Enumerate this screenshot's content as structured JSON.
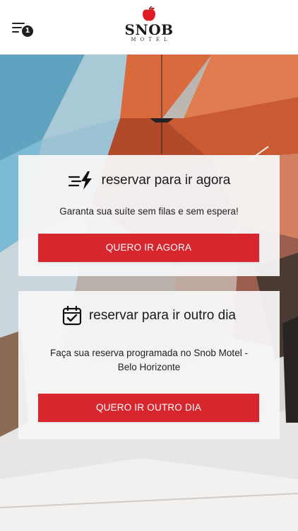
{
  "header": {
    "notification_count": "1",
    "logo": {
      "name": "SNOB",
      "subtitle": "MOTEL"
    }
  },
  "now_card": {
    "icon": "fast-lightning-icon",
    "title": "reservar para ir agora",
    "description": "Garanta sua suíte sem filas e sem espera!",
    "button_label": "QUERO IR AGORA"
  },
  "later_card": {
    "icon": "calendar-check-icon",
    "title": "reservar para ir outro dia",
    "description": "Faça sua reserva programada no Snob Motel - Belo Horizonte",
    "button_label": "QUERO IR OUTRO DIA"
  },
  "colors": {
    "accent": "#d8262f",
    "header_bg": "#ffffff",
    "card_bg": "#f6f6f6"
  }
}
